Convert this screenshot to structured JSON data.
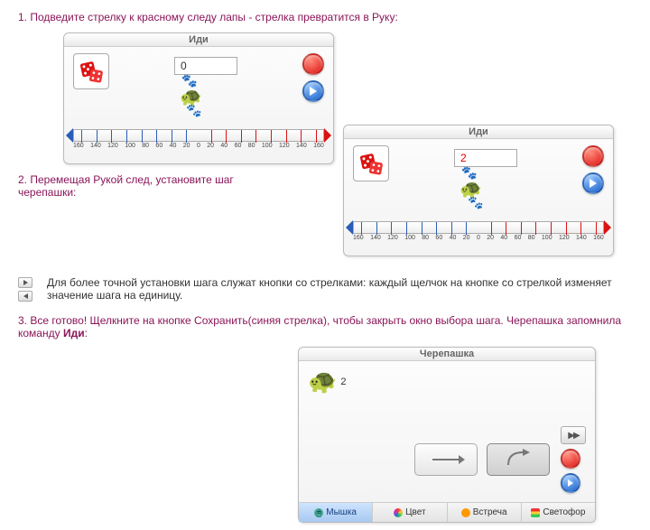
{
  "steps": {
    "s1": "1. Подведите стрелку к красному следу лапы - стрелка превратится в Руку:",
    "s2": "2. Перемещая Рукой след, установите шаг черепашки:",
    "note": "Для более точной установки шага служат кнопки со стрелками: каждый щелчок на кнопке со стрелкой изменяет значение шага на единицу.",
    "s3_a": "3. Все готово! Щелкните на кнопке Сохранить(синяя стрелка), чтобы закрыть окно выбора шага. Черепашка запомнила команду ",
    "s3_b": "Иди",
    "s3_c": ":"
  },
  "panel_go": {
    "title": "Иди",
    "value_zero": "0",
    "value_two": "2",
    "ruler_labels": [
      "160",
      "140",
      "120",
      "100",
      "80",
      "60",
      "40",
      "20",
      "0",
      "20",
      "40",
      "60",
      "80",
      "100",
      "120",
      "140",
      "160"
    ]
  },
  "panel_turtle": {
    "title": "Черепашка",
    "learned_value": "2",
    "tabs": [
      {
        "label": "Мышка",
        "active": true,
        "icon": "mouse-icon"
      },
      {
        "label": "Цвет",
        "active": false,
        "icon": "color-icon"
      },
      {
        "label": "Встреча",
        "active": false,
        "icon": "meet-icon"
      },
      {
        "label": "Светофор",
        "active": false,
        "icon": "traffic-icon"
      }
    ]
  }
}
